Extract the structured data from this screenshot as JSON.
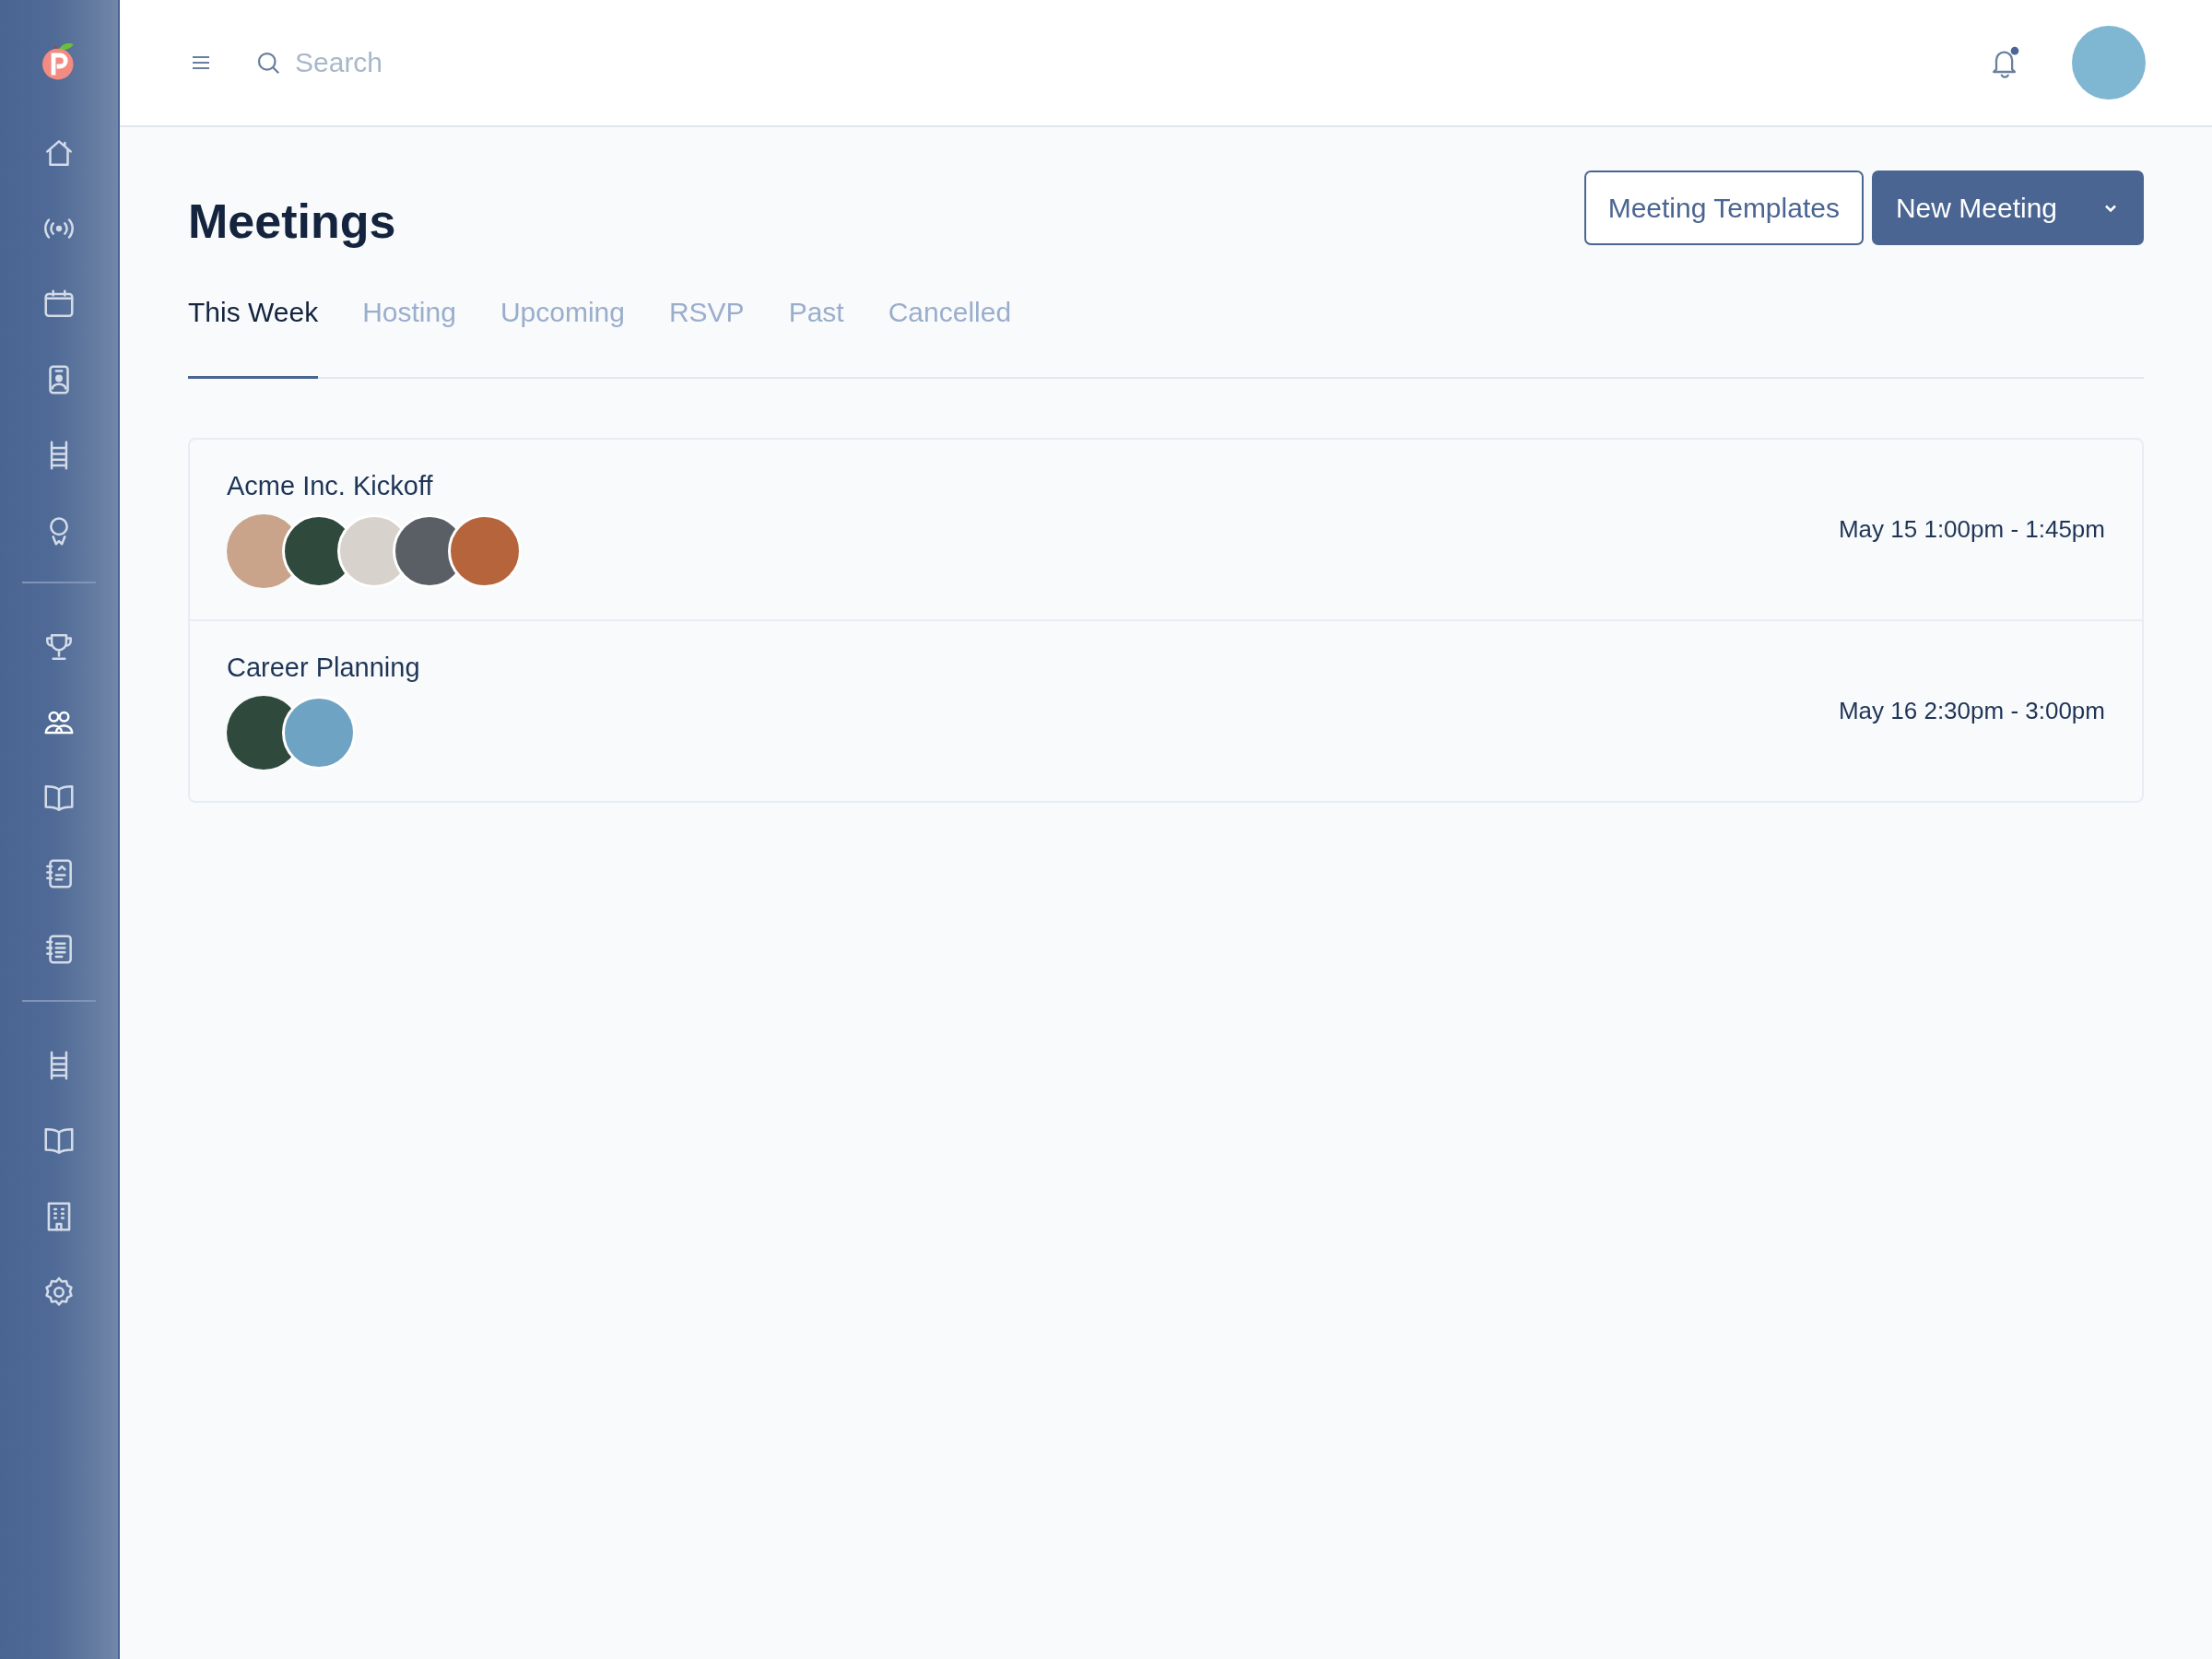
{
  "sidebar": {
    "groups": [
      [
        {
          "selected": false
        },
        {
          "selected": false
        },
        {
          "selected": false
        },
        {
          "selected": false
        },
        {
          "selected": false
        },
        {
          "selected": false
        }
      ],
      [
        {
          "selected": false
        },
        {
          "selected": true
        },
        {
          "selected": false
        },
        {
          "selected": false
        },
        {
          "selected": false
        }
      ],
      [
        {
          "selected": false
        },
        {
          "selected": false
        },
        {
          "selected": false
        },
        {
          "selected": false
        }
      ]
    ]
  },
  "header": {
    "search": {
      "placeholder": "Search"
    },
    "notifications": {
      "unread": true
    }
  },
  "page": {
    "title": "Meetings",
    "buttons": [
      {
        "label": "Meeting Templates",
        "kind": "outline"
      },
      {
        "label": "New Meeting",
        "kind": "split"
      }
    ]
  },
  "tabs": [
    {
      "label": "This Week",
      "selected": true
    },
    {
      "label": "Hosting",
      "selected": false
    },
    {
      "label": "Upcoming",
      "selected": false
    },
    {
      "label": "RSVP",
      "selected": false
    },
    {
      "label": "Past",
      "selected": false
    },
    {
      "label": "Cancelled",
      "selected": false
    }
  ],
  "meetings": [
    {
      "title": "Acme Inc. Kickoff",
      "time": "May 15 1:00pm - 1:45pm",
      "attendees": [
        {
          "color": "#c9a48a"
        },
        {
          "color": "#2f4a3c"
        },
        {
          "color": "#d8d2cc"
        },
        {
          "color": "#5a5f66"
        },
        {
          "color": "#b5643c"
        }
      ]
    },
    {
      "title": "Career Planning",
      "time": "May 16 2:30pm - 3:00pm",
      "attendees": [
        {
          "color": "#2f4a3c"
        },
        {
          "color": "#6fa3c4"
        }
      ]
    }
  ]
}
